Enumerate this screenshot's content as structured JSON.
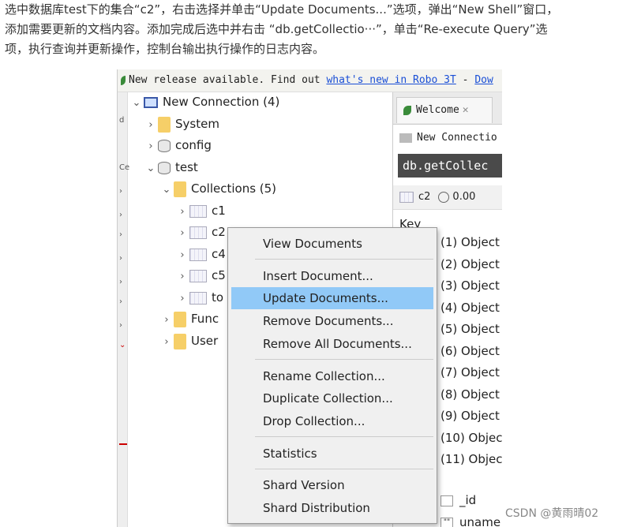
{
  "article": {
    "line1": "选中数据库test下的集合“c2”，右击选择并单击“Update Documents...”选项，弹出“New Shell”窗口，",
    "line2": "添加需要更新的文档内容。添加完成后选中并右击 “db.getCollectio···”，单击“Re-execute Query”选",
    "line3": "项，执行查询并更新操作，控制台输出执行操作的日志内容。"
  },
  "banner": {
    "text": "New release available. Find out ",
    "link": "what's new in Robo 3T",
    "dash": " - ",
    "trail": "Dow"
  },
  "tree": {
    "connection": "New Connection (4)",
    "system": "System",
    "config": "config",
    "test": "test",
    "collections": "Collections (5)",
    "c1": "c1",
    "c2": "c2",
    "c4": "c4",
    "c5": "c5",
    "to": "to",
    "func": "Func",
    "user": "User"
  },
  "right": {
    "tab_welcome": "Welcome",
    "conn": "New Connectio",
    "query": "db.getCollec",
    "res_coll": "c2",
    "res_time": "0.00",
    "key": "Key",
    "objects": [
      "(1) Object",
      "(2) Object",
      "(3) Object",
      "(4) Object",
      "(5) Object",
      "(6) Object",
      "(7) Object",
      "(8) Object",
      "(9) Object",
      "(10) Objec",
      "(11) Objec"
    ],
    "field_id": "_id",
    "field_uname": "uname"
  },
  "menu": {
    "view": "View Documents",
    "insert": "Insert Document...",
    "update": "Update Documents...",
    "remove": "Remove Documents...",
    "remove_all": "Remove All Documents...",
    "rename": "Rename Collection...",
    "duplicate": "Duplicate Collection...",
    "drop": "Drop Collection...",
    "stats": "Statistics",
    "shard_version": "Shard Version",
    "shard_dist": "Shard Distribution"
  },
  "watermark": "CSDN @黄雨晴02"
}
